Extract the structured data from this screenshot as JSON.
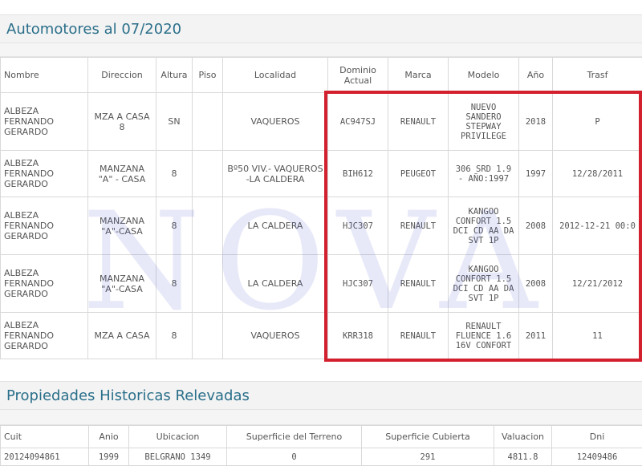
{
  "vehicles": {
    "title": "Automotores al 07/2020",
    "columns": [
      "Nombre",
      "Direccion",
      "Altura",
      "Piso",
      "Localidad",
      "Dominio Actual",
      "Marca",
      "Modelo",
      "Año",
      "Trasf"
    ],
    "rows": [
      {
        "nombre": "ALBEZA FERNANDO GERARDO",
        "direccion": "MZA A CASA 8",
        "altura": "SN",
        "piso": "",
        "localidad": "VAQUEROS",
        "dominio": "AC947SJ",
        "marca": "RENAULT",
        "modelo": "NUEVO SANDERO STEPWAY PRIVILEGE",
        "anio": "2018",
        "trasf": "P"
      },
      {
        "nombre": "ALBEZA FERNANDO GERARDO",
        "direccion": "MANZANA \"A\" - CASA",
        "altura": "8",
        "piso": "",
        "localidad": "Bº50 VIV.- VAQUEROS -LA CALDERA",
        "dominio": "BIH612",
        "marca": "PEUGEOT",
        "modelo": "306 SRD 1.9 - AÑO:1997",
        "anio": "1997",
        "trasf": "12/28/2011"
      },
      {
        "nombre": "ALBEZA FERNANDO GERARDO",
        "direccion": "MANZANA \"A\"-CASA",
        "altura": "8",
        "piso": "",
        "localidad": "LA CALDERA",
        "dominio": "HJC307",
        "marca": "RENAULT",
        "modelo": "KANGOO CONFORT 1.5 DCI CD AA DA SVT 1P",
        "anio": "2008",
        "trasf": "2012-12-21 00:0"
      },
      {
        "nombre": "ALBEZA FERNANDO GERARDO",
        "direccion": "MANZANA \"A\"-CASA",
        "altura": "8",
        "piso": "",
        "localidad": "LA CALDERA",
        "dominio": "HJC307",
        "marca": "RENAULT",
        "modelo": "KANGOO CONFORT 1.5 DCI CD AA DA SVT 1P",
        "anio": "2008",
        "trasf": "12/21/2012"
      },
      {
        "nombre": "ALBEZA FERNANDO GERARDO",
        "direccion": "MZA A CASA",
        "altura": "8",
        "piso": "",
        "localidad": "VAQUEROS",
        "dominio": "KRR318",
        "marca": "RENAULT",
        "modelo": "RENAULT FLUENCE 1.6 16V CONFORT",
        "anio": "2011",
        "trasf": "11"
      }
    ]
  },
  "properties": {
    "title": "Propiedades Historicas Relevadas",
    "columns": [
      "Cuit",
      "Anio",
      "Ubicacion",
      "Superficie del Terreno",
      "Superficie Cubierta",
      "Valuacion",
      "Dni"
    ],
    "rows": [
      {
        "cuit": "20124094861",
        "anio": "1999",
        "ubicacion": "BELGRANO 1349",
        "terreno": "0",
        "cubierta": "291",
        "valuacion": "4811.8",
        "dni": "12409486"
      }
    ]
  },
  "watermark": "NOVA",
  "colors": {
    "title": "#2a6f8a",
    "highlight": "#d3202e",
    "watermark": "#4655c8"
  }
}
